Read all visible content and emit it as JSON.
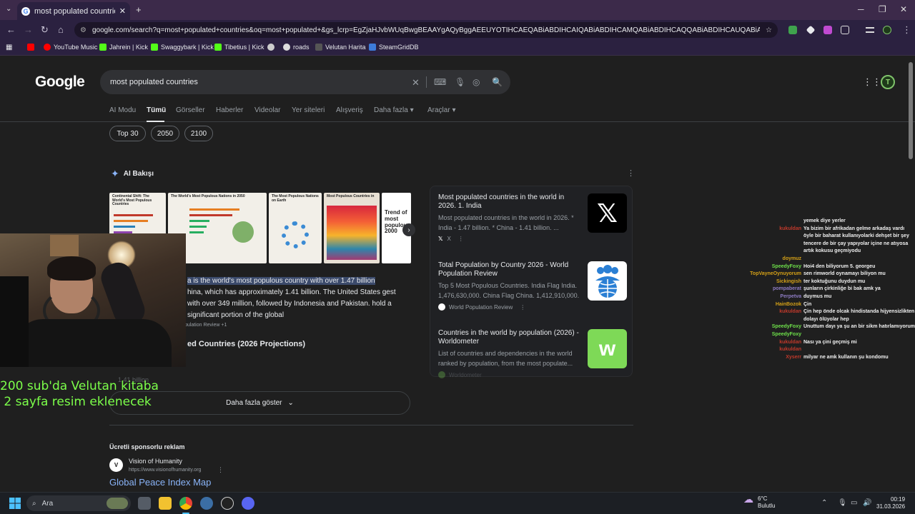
{
  "browser": {
    "tab_title": "most populated countries - Go",
    "url": "google.com/search?q=most+populated+countries&oq=most+populated+&gs_lcrp=EgZjaHJvbWUqBwgBEAAYgAQyBggAEEUYOTIHCAEQABiABDIHCAIQABiABDIHCAMQABiABDIHCAQQABiABDIHCAUQABiABDIHCAYQABiABD...",
    "bookmarks": [
      "YouTube Music",
      "Jahrein | Kick",
      "Swaggybark | Kick",
      "Tibetius | Kick",
      "roads",
      "Velutan Harita",
      "SteamGridDB"
    ]
  },
  "google": {
    "logo": "Google",
    "query": "most populated countries",
    "tabs": [
      "AI Modu",
      "Tümü",
      "Görseller",
      "Haberler",
      "Videolar",
      "Yer siteleri",
      "Alışveriş",
      "Daha fazla",
      "Araçlar"
    ],
    "chips": [
      "Top 30",
      "2050",
      "2100"
    ],
    "ai_overview": {
      "heading": "AI Bakışı",
      "thumbnails": [
        "Continental Shift: The World's Most Populous Countries",
        "The World's Most Populous Nations in 2050",
        "The Most Populous Nations on Earth",
        "Most Populous Countries in",
        "Trend of most populous 2000"
      ],
      "text_highlight": "a is the world's most populous country with over 1.47 billion",
      "text_rest": "hina, which has approximately 1.41 billion. The United States gest with over 349 million, followed by Indonesia and Pakistan. hold a significant portion of the global",
      "source": "pulation Review +1",
      "subheading": "ed Countries (2026 Projections)",
      "faded": "1.41 billion",
      "show_more": "Daha fazla göster"
    },
    "results": [
      {
        "title": "Most populated countries in the world in 2026. 1. India",
        "desc": "Most populated countries in the world in 2026. * India - 1.47 billion. * China - 1.41 billion. ...",
        "source": "X",
        "icon": "x-logo-icon"
      },
      {
        "title": "Total Population by Country 2026 - World Population Review",
        "desc": "Top 5 Most Populous Countries. India Flag India. 1,476,630,000. China Flag China. 1,412,910,000.",
        "source": "World Population Review",
        "icon": "population-globe-icon"
      },
      {
        "title": "Countries in the world by population (2026) - Worldometer",
        "desc": "List of countries and dependencies in the world ranked by population, from the most populate...",
        "source": "Worldometer",
        "icon": "worldometer-logo-icon"
      }
    ],
    "ad": {
      "heading": "Ücretli sponsorlu reklam",
      "name": "Vision of Humanity",
      "url": "https://www.visionofhumanity.org",
      "title": "Global Peace Index Map",
      "favicon": "V"
    }
  },
  "stream": {
    "overlay_text": "200 sub'da Velutan kitaba\n 2 sayfa resim eklenecek",
    "chat": [
      {
        "user": "",
        "text": "yemek diye yerler",
        "color": "#ffffff"
      },
      {
        "user": "kukuldan",
        "text": "Ya bizim bir afrikadan gelme arkadaş vardı öyle bir baharat kullanıyolarki dehşet bir şey tencere de bir çay yapıyolar içine ne atıyosa artık kokusu geçmiyodu",
        "color": "#c0392b"
      },
      {
        "user": "doymuz",
        "text": "",
        "color": "#d4a017"
      },
      {
        "user": "SpeedyFoxy",
        "text": "Hoi4 den biliyorum 5. georgeu",
        "color": "#6ee04a"
      },
      {
        "user": "TopVayneOynuyorum",
        "text": "sen rimworld oynamayı biliyon mu",
        "color": "#d4a017"
      },
      {
        "user": "Sickingish",
        "text": "ter koktuğunu duydun mu",
        "color": "#d4a017"
      },
      {
        "user": "pompaberat",
        "text": "şunların çirkinliğe bi bak amk ya",
        "color": "#8e7cc3"
      },
      {
        "user": "Perpetva",
        "text": "duymus mu",
        "color": "#8e7cc3"
      },
      {
        "user": "HainBozok",
        "text": "Çin",
        "color": "#d4a017"
      },
      {
        "user": "kukuldan",
        "text": "Çin hep önde olcak hindistanda hijyensizlikten dolayı ölüyolar hep",
        "color": "#c0392b"
      },
      {
        "user": "SpeedyFoxy",
        "text": "Unuttum dayı ya şu an bir sikm hatırlamıyorum",
        "color": "#6ee04a"
      },
      {
        "user": "SpeedyFoxy",
        "text": "",
        "color": "#6ee04a"
      },
      {
        "user": "kukuldan",
        "text": "Nası ya çini geçmiş mi",
        "color": "#c0392b"
      },
      {
        "user": "kukuldan",
        "text": "",
        "color": "#c0392b"
      },
      {
        "user": "Xyserr",
        "text": "milyar ne amk kullanın şu kondomu",
        "color": "#c0392b"
      }
    ]
  },
  "taskbar": {
    "search_placeholder": "Ara",
    "weather_temp": "6°C",
    "weather_desc": "Bulutlu",
    "time": "00:19",
    "date": "31.03.2026"
  }
}
